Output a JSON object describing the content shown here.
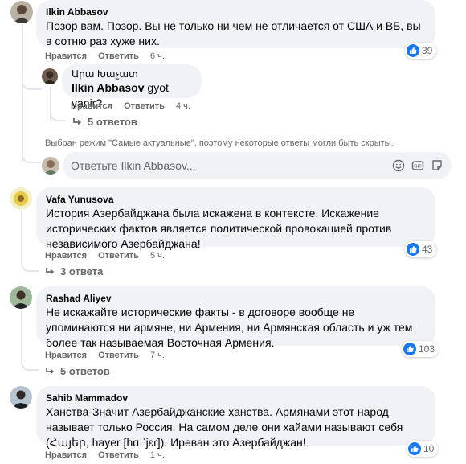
{
  "ui": {
    "like_label": "Нравится",
    "reply_label": "Ответить",
    "accent": "#1877f2",
    "bubble_bg": "#f0f2f5",
    "secondary_text": "#65676b"
  },
  "comments": [
    {
      "author": "Ilkin Abbasov",
      "text": "Позор вам. Позор. Вы не только ни чем не отличается от США и ВБ, вы в сотню раз хуже них.",
      "time": "6 ч.",
      "likes": "39",
      "reply": {
        "author": "Արա Խաչատ",
        "mention": "Ilkin Abbasov",
        "text": "gyot yanir?",
        "time": "4 ч.",
        "replies_label": "5 ответов"
      }
    },
    {
      "author": "Vafa Yunusova",
      "text": "История Азербайджана была искажена в контексте. Искажение исторических фактов является политической провокацией против независимого Азербайджана!",
      "time": "5 ч.",
      "likes": "43",
      "replies_label": "3 ответа"
    },
    {
      "author": "Rashad Aliyev",
      "text": "Не искажайте исторические факты - в договоре вообще не упоминаются ни армяне, ни Армения, ни Армянская область и уж тем более так называемая Восточная Армения.",
      "time": "7 ч.",
      "likes": "103",
      "replies_label": "5 ответов"
    },
    {
      "author": "Sahib Mammadov",
      "text": "Ханства-Значит Азербайджанские ханства. Армянами этот народ называет только Россия. На самом деле они хайами называют себя (Հայեր, hayer [hɑ ˈjɛɾ]). Иреван это Азербайджан!",
      "time": "1 ч.",
      "likes": "10"
    }
  ],
  "notice": "Выбран режим \"Самые актуальные\", поэтому некоторые ответы могли быть скрыты.",
  "reply_box": {
    "placeholder": "Ответьте Ilkin Abbasov..."
  },
  "icons": {
    "reaction": "like-icon",
    "replies": "reply-arrow-icon",
    "reply_box_tools": [
      "emoji-icon",
      "gif-icon",
      "sticker-icon"
    ]
  }
}
